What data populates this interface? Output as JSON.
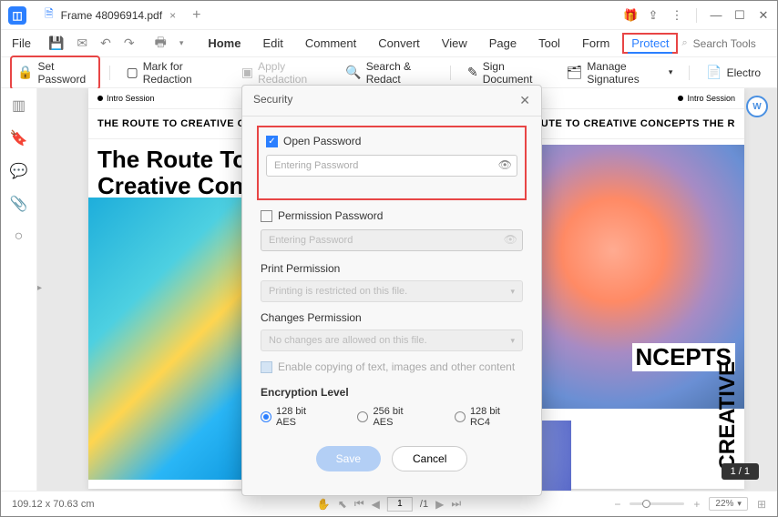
{
  "titlebar": {
    "filename": "Frame 48096914.pdf"
  },
  "menu": {
    "file": "File",
    "home": "Home",
    "edit": "Edit",
    "comment": "Comment",
    "convert": "Convert",
    "view": "View",
    "page": "Page",
    "tool": "Tool",
    "form": "Form",
    "protect": "Protect",
    "search_placeholder": "Search Tools"
  },
  "toolbar": {
    "set_password": "Set Password",
    "mark_redaction": "Mark for Redaction",
    "apply_redaction": "Apply Redaction",
    "search_redact": "Search & Redact",
    "sign_document": "Sign Document",
    "manage_sigs": "Manage Signatures",
    "electro": "Electro"
  },
  "document": {
    "session_left": "Intro Session",
    "session_right": "Intro Session",
    "banner_left": "THE ROUTE TO CREATIVE CONCEPT",
    "banner_right": "S THE ROUTE TO CREATIVE CONCEPTS THE R",
    "hero_title1": "The Route To",
    "hero_title2": "Creative Conce",
    "concepts": "NCEPTS",
    "creative_vert": "CREATIVE",
    "ai_badge": "W"
  },
  "modal": {
    "title": "Security",
    "open_password": "Open Password",
    "open_placeholder": "Entering Password",
    "permission_password": "Permission Password",
    "perm_placeholder": "Entering Password",
    "print_permission": "Print Permission",
    "print_value": "Printing is restricted on this file.",
    "changes_permission": "Changes Permission",
    "changes_value": "No changes are allowed on this file.",
    "enable_copy": "Enable copying of text, images and other content",
    "encryption_level": "Encryption Level",
    "enc_128_aes": "128 bit AES",
    "enc_256_aes": "256 bit AES",
    "enc_128_rc4": "128 bit RC4",
    "save": "Save",
    "cancel": "Cancel"
  },
  "status": {
    "dimensions": "109.12 x 70.63 cm",
    "page_current": "1",
    "page_total": "/1",
    "zoom": "22%",
    "page_indicator": "1 / 1"
  }
}
